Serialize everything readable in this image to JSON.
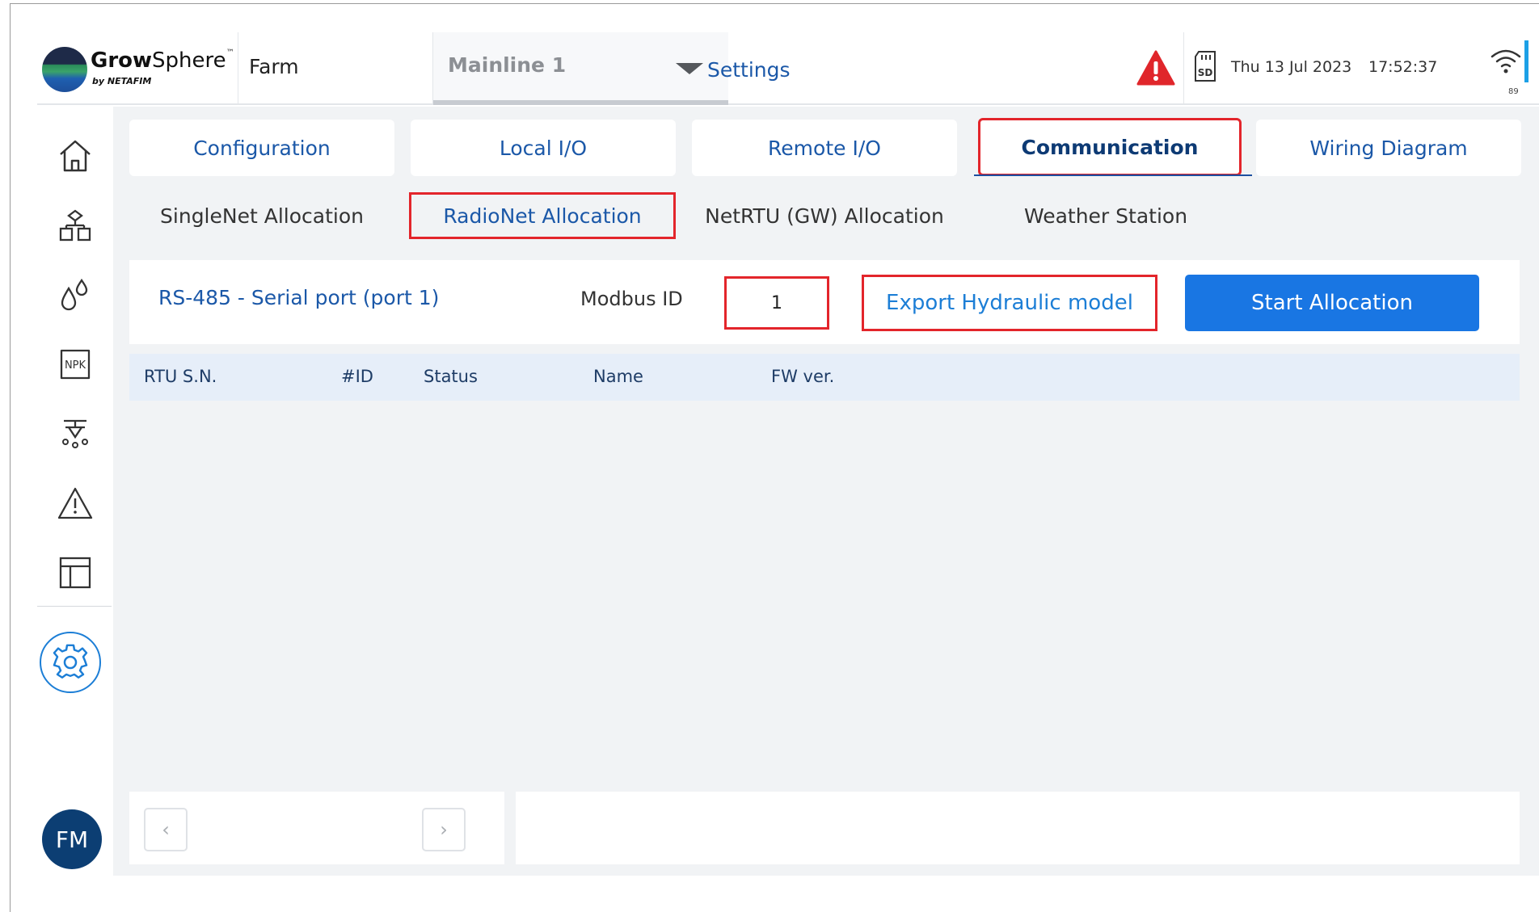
{
  "header": {
    "logo": {
      "brand_bold": "Grow",
      "brand_light": "Sphere",
      "tm": "™",
      "by": "by NETAFIM"
    },
    "farm": "Farm",
    "mainline": "Mainline 1",
    "page": "Settings",
    "date": "Thu 13 Jul 2023",
    "time": "17:52:37",
    "sd_label": "SD",
    "wifi_level": "89"
  },
  "sidebar": {
    "items": [
      "home-icon",
      "network-icon",
      "water-drops-icon",
      "npk-icon",
      "irrigation-icon",
      "alert-icon",
      "layout-icon"
    ],
    "npk_label": "NPK",
    "active": "gear-icon",
    "avatar": "FM"
  },
  "tabs": [
    {
      "label": "Configuration"
    },
    {
      "label": "Local I/O"
    },
    {
      "label": "Remote  I/O"
    },
    {
      "label": "Communication",
      "active": true
    },
    {
      "label": "Wiring Diagram"
    }
  ],
  "subtabs": [
    {
      "label": "SingleNet Allocation"
    },
    {
      "label": "RadioNet Allocation",
      "active": true
    },
    {
      "label": "NetRTU (GW) Allocation"
    },
    {
      "label": "Weather Station"
    }
  ],
  "toolbar": {
    "port": "RS-485 - Serial port (port 1)",
    "modbus_label": "Modbus ID",
    "modbus_value": "1",
    "export_label": "Export Hydraulic model",
    "start_label": "Start Allocation"
  },
  "table": {
    "columns": [
      "RTU S.N.",
      "#ID",
      "Status",
      "Name",
      "FW ver."
    ],
    "rows": []
  },
  "pager": {
    "prev": "‹",
    "next": "›"
  },
  "colors": {
    "accent": "#1976e3",
    "highlight_box": "#e3252b",
    "nav_text": "#1b58a8",
    "avatar": "#0c3e73",
    "alert": "#e0262b"
  }
}
